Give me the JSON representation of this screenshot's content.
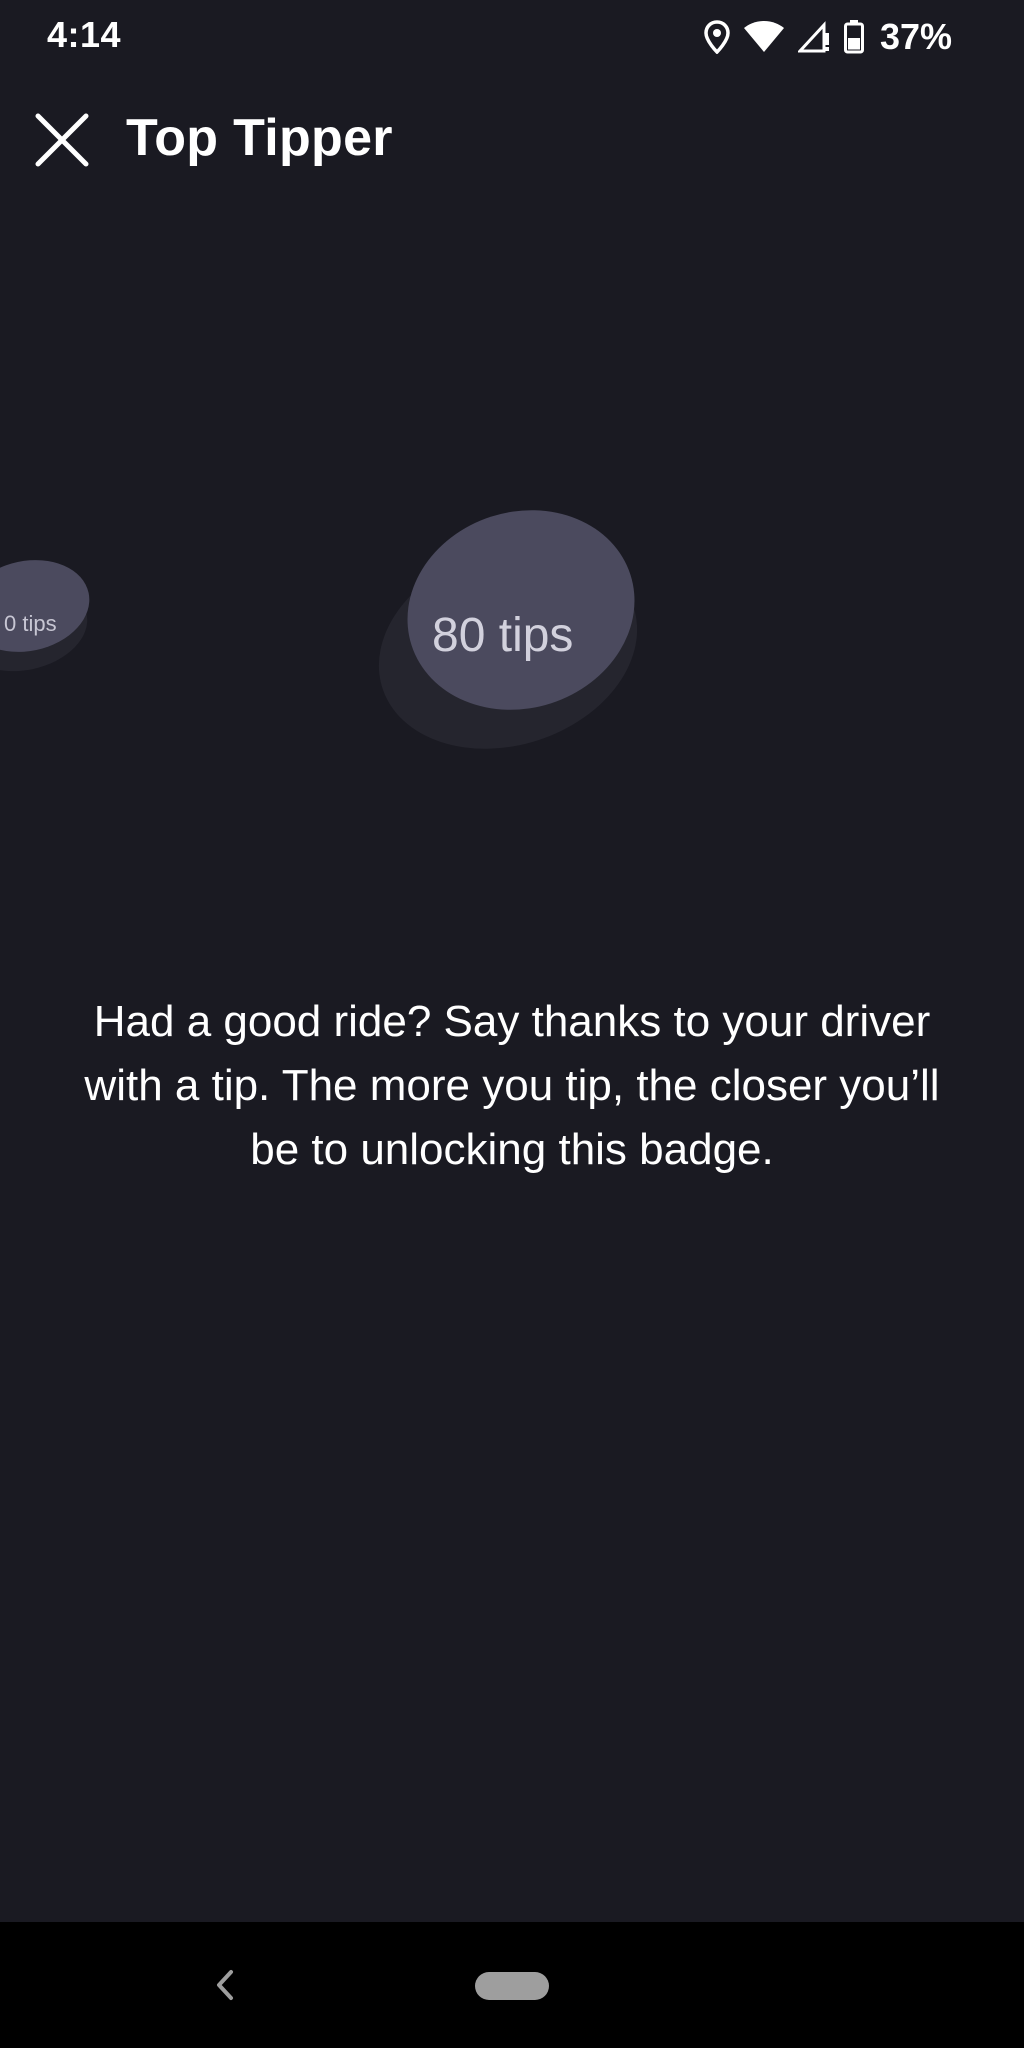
{
  "status_bar": {
    "time": "4:14",
    "icons": [
      "location-icon",
      "wifi-icon",
      "cell-signal-icon",
      "battery-icon"
    ],
    "battery_percent": "37%"
  },
  "app_bar": {
    "close_icon": "close-icon",
    "title": "Top Tipper"
  },
  "badges": [
    {
      "label": "0 tips",
      "state": "partially visible"
    },
    {
      "label": "80 tips",
      "state": "selected"
    }
  ],
  "description": "Had a good ride? Say thanks to your driver with a tip. The more you tip, the closer you’ll be to unlocking this badge.",
  "nav_bar": {
    "back_icon": "back-chevron-icon",
    "home_icon": "home-pill-icon"
  },
  "colors": {
    "background": "#1a1a22",
    "badge_face": "#4b4a5e",
    "badge_shadow": "#25252e",
    "nav_background": "#000000"
  }
}
